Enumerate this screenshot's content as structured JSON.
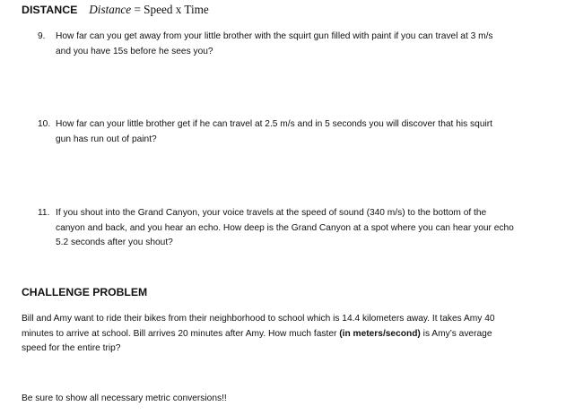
{
  "header": {
    "label": "DISTANCE",
    "formula_var": "Distance",
    "formula_rest": "= Speed x Time"
  },
  "questions": [
    {
      "number": "9.",
      "lines": [
        "How far can you get away from your little brother with the squirt gun filled with paint if you can travel at 3 m/s",
        "and you have 15s before he sees you?"
      ]
    },
    {
      "number": "10.",
      "lines": [
        "How far can your little brother get if he can travel at 2.5 m/s and in 5 seconds you will discover that his squirt",
        "gun has run out of paint?"
      ]
    },
    {
      "number": "11.",
      "lines": [
        "If you shout into the Grand Canyon, your voice travels at the speed of sound (340 m/s) to the bottom of the",
        "canyon and back, and you hear an echo.  How deep is the Grand Canyon at a spot where you can hear your echo",
        "5.2 seconds after you shout?"
      ]
    }
  ],
  "challenge": {
    "title": "CHALLENGE PROBLEM",
    "line1": "Bill and Amy want to ride their bikes from their neighborhood to school which is 14.4 kilometers away.  It takes Amy 40",
    "line2_pre": "minutes to arrive at school.  Bill arrives 20 minutes after Amy.  How much faster ",
    "line2_bold": "(in meters/second)",
    "line2_post": " is Amy’s average",
    "line3": "speed for the entire trip?"
  },
  "note": "Be sure to show all necessary metric conversions!!"
}
